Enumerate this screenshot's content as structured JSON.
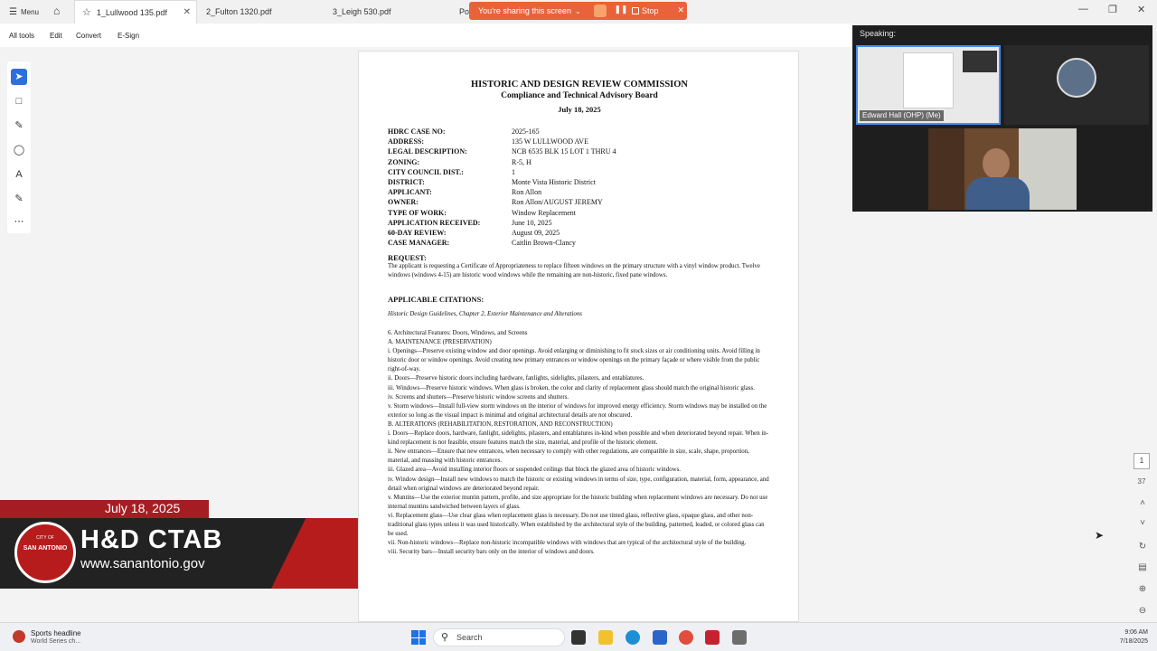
{
  "tabs": {
    "menu_label": "Menu",
    "items": [
      {
        "label": "1_Lullwood 135.pdf"
      },
      {
        "label": "2_Fulton 1320.pdf"
      },
      {
        "label": "3_Leigh 530.pdf"
      },
      {
        "label": "Po"
      }
    ]
  },
  "sharing": {
    "text": "You're sharing this screen",
    "stop_label": "Stop"
  },
  "toolbar": {
    "all_tools": "All tools",
    "edit": "Edit",
    "convert": "Convert",
    "esign": "E-Sign"
  },
  "document": {
    "title": "HISTORIC AND DESIGN REVIEW COMMISSION",
    "subtitle": "Compliance and Technical Advisory Board",
    "date": "July 18, 2025",
    "fields": [
      {
        "label": "HDRC CASE NO:",
        "value": "2025-165"
      },
      {
        "label": "ADDRESS:",
        "value": "135 W LULLWOOD AVE"
      },
      {
        "label": "LEGAL DESCRIPTION:",
        "value": "NCB 6535 BLK 15 LOT 1 THRU 4"
      },
      {
        "label": "ZONING:",
        "value": "R-5, H"
      },
      {
        "label": "CITY COUNCIL DIST.:",
        "value": "1"
      },
      {
        "label": "DISTRICT:",
        "value": "Monte Vista Historic District"
      },
      {
        "label": "APPLICANT:",
        "value": "Ron Allon"
      },
      {
        "label": "OWNER:",
        "value": "Ron Allon/AUGUST JEREMY"
      },
      {
        "label": "TYPE OF WORK:",
        "value": "Window Replacement"
      },
      {
        "label": "APPLICATION RECEIVED:",
        "value": "June 10, 2025"
      },
      {
        "label": "60-DAY REVIEW:",
        "value": "August 09, 2025"
      },
      {
        "label": "CASE MANAGER:",
        "value": "Caitlin Brown-Clancy"
      }
    ],
    "request_heading": "REQUEST:",
    "request_text": "The applicant is requesting a Certificate of Appropriateness to replace fifteen windows on the primary structure with a vinyl window product. Twelve windows (windows 4-15) are historic wood windows while the remaining are non-historic, fixed pane windows.",
    "citations_heading": "APPLICABLE CITATIONS:",
    "guideline_ref": "Historic Design Guidelines, Chapter 2, Exterior Maintenance and Alterations",
    "body": [
      "6. Architectural Features: Doors, Windows, and Screens",
      "A. MAINTENANCE (PRESERVATION)",
      "i. Openings—Preserve existing window and door openings. Avoid enlarging or diminishing to fit stock sizes or air conditioning units. Avoid filling in historic door or window openings. Avoid creating new primary entrances or window openings on the primary façade or where visible from the public right-of-way.",
      "ii. Doors—Preserve historic doors including hardware, fanlights, sidelights, pilasters, and entablatures.",
      "iii. Windows—Preserve historic windows. When glass is broken, the color and clarity of replacement glass should match the original historic glass.",
      "iv. Screens and shutters—Preserve historic window screens and shutters.",
      "v. Storm windows—Install full-view storm windows on the interior of windows for improved energy efficiency. Storm windows may be installed on the exterior so long as the visual impact is minimal and original architectural details are not obscured.",
      "B. ALTERATIONS (REHABILITATION, RESTORATION, AND RECONSTRUCTION)",
      "i. Doors—Replace doors, hardware, fanlight, sidelights, pilasters, and entablatures in-kind when possible and when deteriorated beyond repair. When in-kind replacement is not feasible, ensure features match the size, material, and profile of the historic element.",
      "ii. New entrances—Ensure that new entrances, when necessary to comply with other regulations, are compatible in size, scale, shape, proportion, material, and massing with historic entrances.",
      "iii. Glazed area—Avoid installing interior floors or suspended ceilings that block the glazed area of historic windows.",
      "iv. Window design—Install new windows to match the historic or existing windows in terms of size, type, configuration, material, form, appearance, and detail when original windows are deteriorated beyond repair.",
      "v. Muntins—Use the exterior muntin pattern, profile, and size appropriate for the historic building when replacement windows are necessary. Do not use internal muntins sandwiched between layers of glass.",
      "vi. Replacement glass—Use clear glass when replacement glass is necessary. Do not use tinted glass, reflective glass, opaque glass, and other non-traditional glass types unless it was used historically. When established by the architectural style of the building, patterned, leaded, or colored glass can be used.",
      "vii. Non-historic windows—Replace non-historic incompatible windows with windows that are typical of the architectural style of the building.",
      "viii. Security bars—Install security bars only on the interior of windows and doors."
    ]
  },
  "pager": {
    "current": "1",
    "total": "37"
  },
  "video": {
    "speaking_label": "Speaking:",
    "participant_name": "Edward Hall (OHP) (Me)"
  },
  "broadcast": {
    "date": "July 18, 2025",
    "title": "H&D CTAB",
    "url": "www.sanantonio.gov",
    "seal_line1": "CITY OF",
    "seal_line2": "SAN ANTONIO"
  },
  "taskbar": {
    "news_title": "Sports headline",
    "news_sub": "World Series ch...",
    "search_placeholder": "Search",
    "time": "9:06 AM",
    "date": "7/18/2025"
  },
  "colors": {
    "accent": "#2e6fd9",
    "share_bar": "#e8623a",
    "broadcast_red": "#a51d23"
  }
}
